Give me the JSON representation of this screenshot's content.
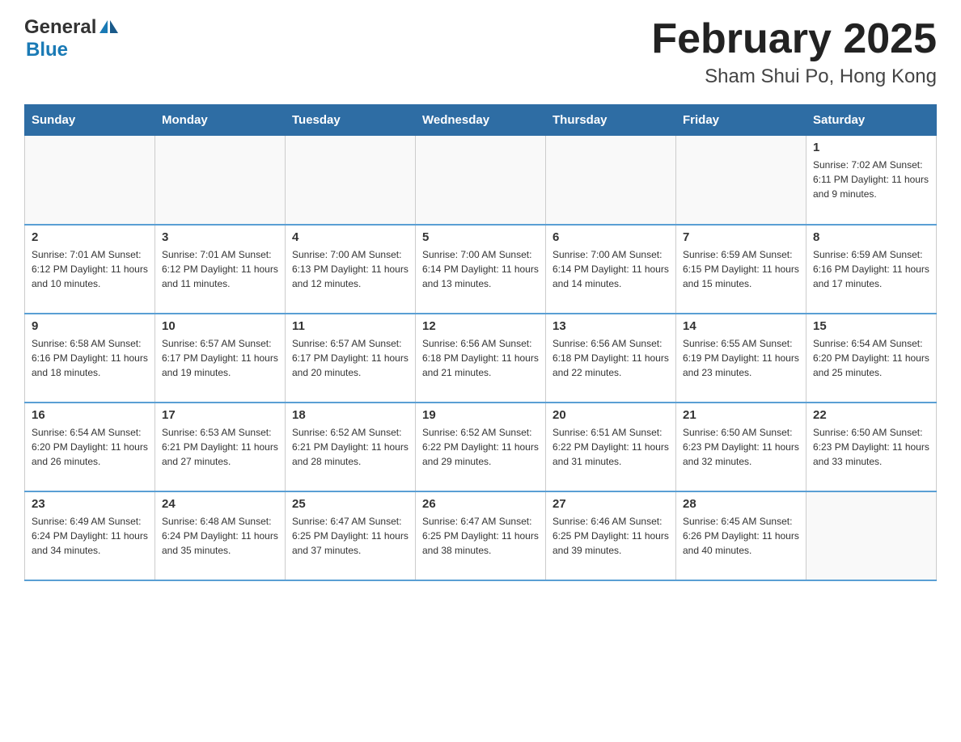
{
  "header": {
    "logo_general": "General",
    "logo_blue": "Blue",
    "month_title": "February 2025",
    "location": "Sham Shui Po, Hong Kong"
  },
  "weekdays": [
    "Sunday",
    "Monday",
    "Tuesday",
    "Wednesday",
    "Thursday",
    "Friday",
    "Saturday"
  ],
  "weeks": [
    [
      {
        "day": "",
        "info": ""
      },
      {
        "day": "",
        "info": ""
      },
      {
        "day": "",
        "info": ""
      },
      {
        "day": "",
        "info": ""
      },
      {
        "day": "",
        "info": ""
      },
      {
        "day": "",
        "info": ""
      },
      {
        "day": "1",
        "info": "Sunrise: 7:02 AM\nSunset: 6:11 PM\nDaylight: 11 hours and 9 minutes."
      }
    ],
    [
      {
        "day": "2",
        "info": "Sunrise: 7:01 AM\nSunset: 6:12 PM\nDaylight: 11 hours and 10 minutes."
      },
      {
        "day": "3",
        "info": "Sunrise: 7:01 AM\nSunset: 6:12 PM\nDaylight: 11 hours and 11 minutes."
      },
      {
        "day": "4",
        "info": "Sunrise: 7:00 AM\nSunset: 6:13 PM\nDaylight: 11 hours and 12 minutes."
      },
      {
        "day": "5",
        "info": "Sunrise: 7:00 AM\nSunset: 6:14 PM\nDaylight: 11 hours and 13 minutes."
      },
      {
        "day": "6",
        "info": "Sunrise: 7:00 AM\nSunset: 6:14 PM\nDaylight: 11 hours and 14 minutes."
      },
      {
        "day": "7",
        "info": "Sunrise: 6:59 AM\nSunset: 6:15 PM\nDaylight: 11 hours and 15 minutes."
      },
      {
        "day": "8",
        "info": "Sunrise: 6:59 AM\nSunset: 6:16 PM\nDaylight: 11 hours and 17 minutes."
      }
    ],
    [
      {
        "day": "9",
        "info": "Sunrise: 6:58 AM\nSunset: 6:16 PM\nDaylight: 11 hours and 18 minutes."
      },
      {
        "day": "10",
        "info": "Sunrise: 6:57 AM\nSunset: 6:17 PM\nDaylight: 11 hours and 19 minutes."
      },
      {
        "day": "11",
        "info": "Sunrise: 6:57 AM\nSunset: 6:17 PM\nDaylight: 11 hours and 20 minutes."
      },
      {
        "day": "12",
        "info": "Sunrise: 6:56 AM\nSunset: 6:18 PM\nDaylight: 11 hours and 21 minutes."
      },
      {
        "day": "13",
        "info": "Sunrise: 6:56 AM\nSunset: 6:18 PM\nDaylight: 11 hours and 22 minutes."
      },
      {
        "day": "14",
        "info": "Sunrise: 6:55 AM\nSunset: 6:19 PM\nDaylight: 11 hours and 23 minutes."
      },
      {
        "day": "15",
        "info": "Sunrise: 6:54 AM\nSunset: 6:20 PM\nDaylight: 11 hours and 25 minutes."
      }
    ],
    [
      {
        "day": "16",
        "info": "Sunrise: 6:54 AM\nSunset: 6:20 PM\nDaylight: 11 hours and 26 minutes."
      },
      {
        "day": "17",
        "info": "Sunrise: 6:53 AM\nSunset: 6:21 PM\nDaylight: 11 hours and 27 minutes."
      },
      {
        "day": "18",
        "info": "Sunrise: 6:52 AM\nSunset: 6:21 PM\nDaylight: 11 hours and 28 minutes."
      },
      {
        "day": "19",
        "info": "Sunrise: 6:52 AM\nSunset: 6:22 PM\nDaylight: 11 hours and 29 minutes."
      },
      {
        "day": "20",
        "info": "Sunrise: 6:51 AM\nSunset: 6:22 PM\nDaylight: 11 hours and 31 minutes."
      },
      {
        "day": "21",
        "info": "Sunrise: 6:50 AM\nSunset: 6:23 PM\nDaylight: 11 hours and 32 minutes."
      },
      {
        "day": "22",
        "info": "Sunrise: 6:50 AM\nSunset: 6:23 PM\nDaylight: 11 hours and 33 minutes."
      }
    ],
    [
      {
        "day": "23",
        "info": "Sunrise: 6:49 AM\nSunset: 6:24 PM\nDaylight: 11 hours and 34 minutes."
      },
      {
        "day": "24",
        "info": "Sunrise: 6:48 AM\nSunset: 6:24 PM\nDaylight: 11 hours and 35 minutes."
      },
      {
        "day": "25",
        "info": "Sunrise: 6:47 AM\nSunset: 6:25 PM\nDaylight: 11 hours and 37 minutes."
      },
      {
        "day": "26",
        "info": "Sunrise: 6:47 AM\nSunset: 6:25 PM\nDaylight: 11 hours and 38 minutes."
      },
      {
        "day": "27",
        "info": "Sunrise: 6:46 AM\nSunset: 6:25 PM\nDaylight: 11 hours and 39 minutes."
      },
      {
        "day": "28",
        "info": "Sunrise: 6:45 AM\nSunset: 6:26 PM\nDaylight: 11 hours and 40 minutes."
      },
      {
        "day": "",
        "info": ""
      }
    ]
  ]
}
